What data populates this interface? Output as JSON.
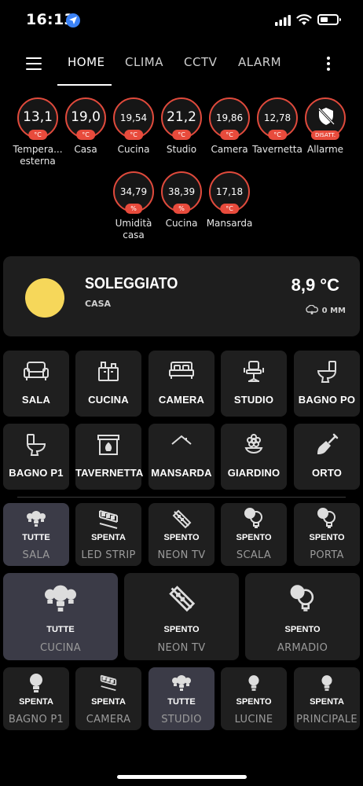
{
  "status_bar": {
    "time": "16:13"
  },
  "nav": {
    "tabs": [
      {
        "label": "HOME"
      },
      {
        "label": "CLIMA"
      },
      {
        "label": "CCTV"
      },
      {
        "label": "ALARM"
      }
    ],
    "active_tab": "HOME"
  },
  "sensors": [
    {
      "value": "13,1",
      "unit": "°C",
      "label": "Tempera... esterna"
    },
    {
      "value": "19,0",
      "unit": "°C",
      "label": "Casa"
    },
    {
      "value": "19,54",
      "unit": "°C",
      "label": "Cucina"
    },
    {
      "value": "21,2",
      "unit": "°C",
      "label": "Studio"
    },
    {
      "value": "19,86",
      "unit": "°C",
      "label": "Camera"
    },
    {
      "value": "12,78",
      "unit": "°C",
      "label": "Tavernetta"
    },
    {
      "value": "",
      "unit": "DISATT.",
      "label": "Allarme",
      "icon": "shield-off-icon"
    },
    {
      "value": "34,79",
      "unit": "%",
      "label": "Umidità casa"
    },
    {
      "value": "38,39",
      "unit": "%",
      "label": "Cucina"
    },
    {
      "value": "17,18",
      "unit": "°C",
      "label": "Mansarda"
    }
  ],
  "weather": {
    "condition": "SOLEGGIATO",
    "location": "CASA",
    "temperature": "8,9 °C",
    "rain": "0 MM",
    "icon": "sun-icon"
  },
  "rooms": [
    {
      "name": "SALA",
      "icon": "sofa-icon"
    },
    {
      "name": "CUCINA",
      "icon": "kitchen-icon"
    },
    {
      "name": "CAMERA",
      "icon": "bed-icon"
    },
    {
      "name": "STUDIO",
      "icon": "office-chair-icon"
    },
    {
      "name": "BAGNO PO",
      "icon": "toilet-icon"
    },
    {
      "name": "BAGNO P1",
      "icon": "toilet-icon"
    },
    {
      "name": "TAVERNETTA",
      "icon": "fireplace-icon"
    },
    {
      "name": "MANSARDA",
      "icon": "roof-icon"
    },
    {
      "name": "GIARDINO",
      "icon": "flower-icon"
    },
    {
      "name": "ORTO",
      "icon": "shovel-icon"
    }
  ],
  "lights": [
    {
      "state": "TUTTE",
      "name": "SALA",
      "on": true,
      "icon": "lightbulb-group-icon"
    },
    {
      "state": "SPENTA",
      "name": "LED STRIP",
      "on": false,
      "icon": "led-strip-icon"
    },
    {
      "state": "SPENTO",
      "name": "NEON TV",
      "on": false,
      "icon": "led-strip-icon"
    },
    {
      "state": "SPENTO",
      "name": "SCALA",
      "on": false,
      "icon": "lightbulb-multiple-icon"
    },
    {
      "state": "SPENTO",
      "name": "PORTA",
      "on": false,
      "icon": "lightbulb-multiple-icon"
    },
    {
      "state": "TUTTE",
      "name": "CUCINA",
      "on": true,
      "icon": "lightbulb-group-icon"
    },
    {
      "state": "SPENTO",
      "name": "NEON TV",
      "on": false,
      "icon": "led-strip-icon"
    },
    {
      "state": "SPENTO",
      "name": "ARMADIO",
      "on": false,
      "icon": "lightbulb-multiple-icon"
    },
    {
      "state": "SPENTA",
      "name": "BAGNO P1",
      "on": false,
      "icon": "lightbulb-icon"
    },
    {
      "state": "SPENTA",
      "name": "CAMERA",
      "on": false,
      "icon": "led-strip-icon"
    },
    {
      "state": "TUTTE",
      "name": "STUDIO",
      "on": true,
      "icon": "lightbulb-group-icon"
    },
    {
      "state": "SPENTO",
      "name": "LUCINE",
      "on": false,
      "icon": "lightbulb-icon"
    },
    {
      "state": "SPENTA",
      "name": "PRINCIPALE",
      "on": false,
      "icon": "lightbulb-icon"
    }
  ],
  "colors": {
    "background": "#000000",
    "card": "#1f1f1f",
    "card_active": "#3b3b47",
    "sensor_ring": "#e04a3c",
    "sun": "#f6d75a"
  }
}
